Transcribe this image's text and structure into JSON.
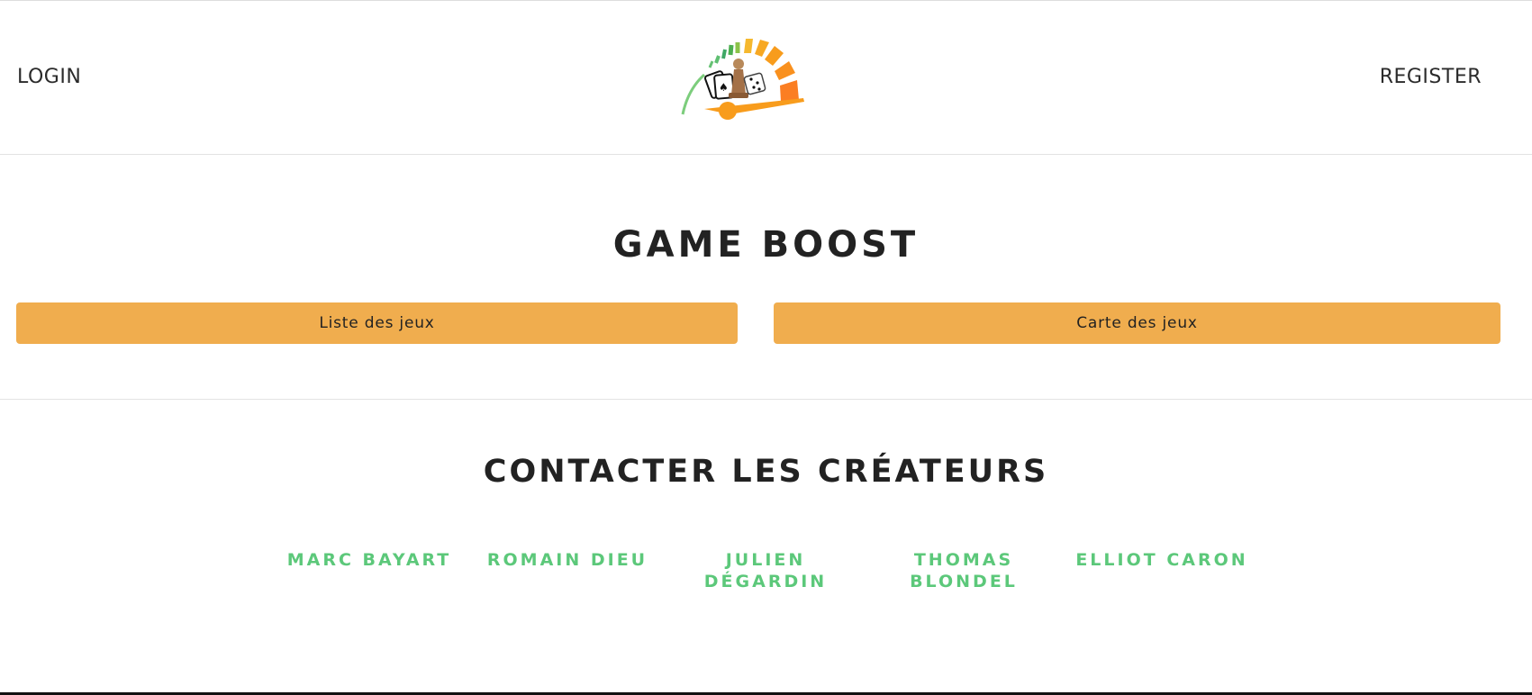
{
  "header": {
    "login_label": "LOGIN",
    "register_label": "REGISTER",
    "logo_icon": "speedometer-game-logo-icon"
  },
  "hero": {
    "title": "GAME BOOST",
    "buttons": [
      {
        "label": "Liste des jeux"
      },
      {
        "label": "Carte des jeux"
      }
    ]
  },
  "contact": {
    "title": "CONTACTER LES CRÉATEURS",
    "creators": [
      {
        "name": "MARC BAYART"
      },
      {
        "name": "ROMAIN DIEU"
      },
      {
        "name": "JULIEN DÉGARDIN"
      },
      {
        "name": "THOMAS BLONDEL"
      },
      {
        "name": "ELLIOT CARON"
      }
    ]
  },
  "colors": {
    "button_bg": "#f0ad4e",
    "creator_link": "#5cc87a",
    "text": "#222222"
  }
}
